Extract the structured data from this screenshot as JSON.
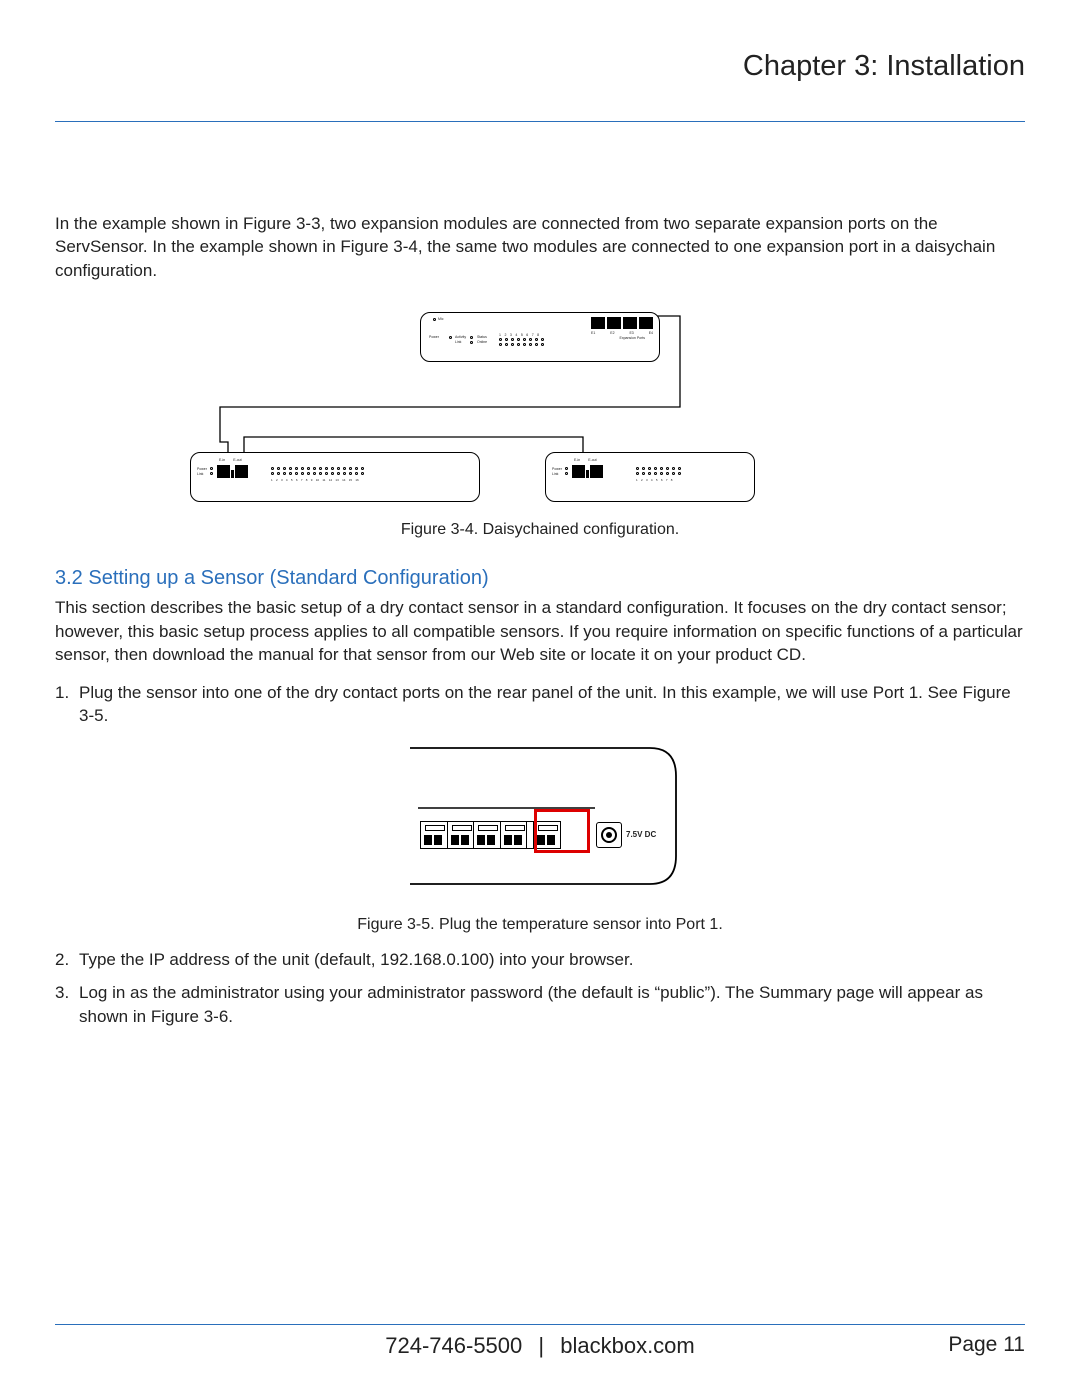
{
  "header": {
    "chapter_title": "Chapter 3: Installation"
  },
  "intro_text": "In the example shown in Figure 3-3, two expansion modules are connected from two separate expansion ports on the ServSensor. In the example shown in Figure 3-4, the same two modules are connected to one expansion port in a daisychain configuration.",
  "figure34": {
    "caption": "Figure 3-4. Daisychained configuration.",
    "main_device": {
      "mic_label": "Mic",
      "left_rows": [
        "Power",
        "Activity",
        "Link"
      ],
      "status_label": "Status",
      "online_label": "Online",
      "exp_port_labels": [
        "E1",
        "E2",
        "E3",
        "E4"
      ],
      "exp_caption": "Expansion Ports",
      "led_numbers": [
        "1",
        "2",
        "3",
        "4",
        "5",
        "6",
        "7",
        "8"
      ]
    },
    "sub_a": {
      "top_labels": [
        "E-in",
        "E-out"
      ],
      "left_rows": [
        "Power",
        "Link"
      ],
      "led_numbers": [
        "1",
        "2",
        "3",
        "4",
        "5",
        "6",
        "7",
        "8",
        "9",
        "10",
        "11",
        "12",
        "13",
        "14",
        "15",
        "16"
      ]
    },
    "sub_b": {
      "top_labels": [
        "E-in",
        "E-out"
      ],
      "left_rows": [
        "Power",
        "Link"
      ],
      "led_numbers": [
        "1",
        "2",
        "3",
        "4",
        "5",
        "6",
        "7",
        "8"
      ]
    }
  },
  "section": {
    "heading": "3.2 Setting up a Sensor (Standard Configuration)",
    "body": "This section describes the basic setup of a dry contact sensor in a standard configuration. It focuses on the dry contact sensor; however, this basic setup process applies to all compatible sensors. If you require information on specific functions of a particular sensor, then download the manual for that sensor from our Web site or locate it on your product CD."
  },
  "steps": {
    "s1_num": "1.",
    "s1_text": "Plug the sensor into one of the dry contact ports on the rear panel of the unit. In this example, we will use Port 1. See Figure 3-5.",
    "s2_num": "2.",
    "s2_text": "Type the IP address of the unit (default, 192.168.0.100) into your browser.",
    "s3_num": "3.",
    "s3_text": "Log in as the administrator using your administrator password (the default is “public”). The Summary page will appear as shown in Figure 3-6."
  },
  "figure35": {
    "caption": "Figure 3-5. Plug the temperature sensor into Port 1.",
    "dc_label": "7.5V DC"
  },
  "footer": {
    "phone": "724-746-5500",
    "separator": "|",
    "site": "blackbox.com",
    "page_label": "Page 11"
  }
}
